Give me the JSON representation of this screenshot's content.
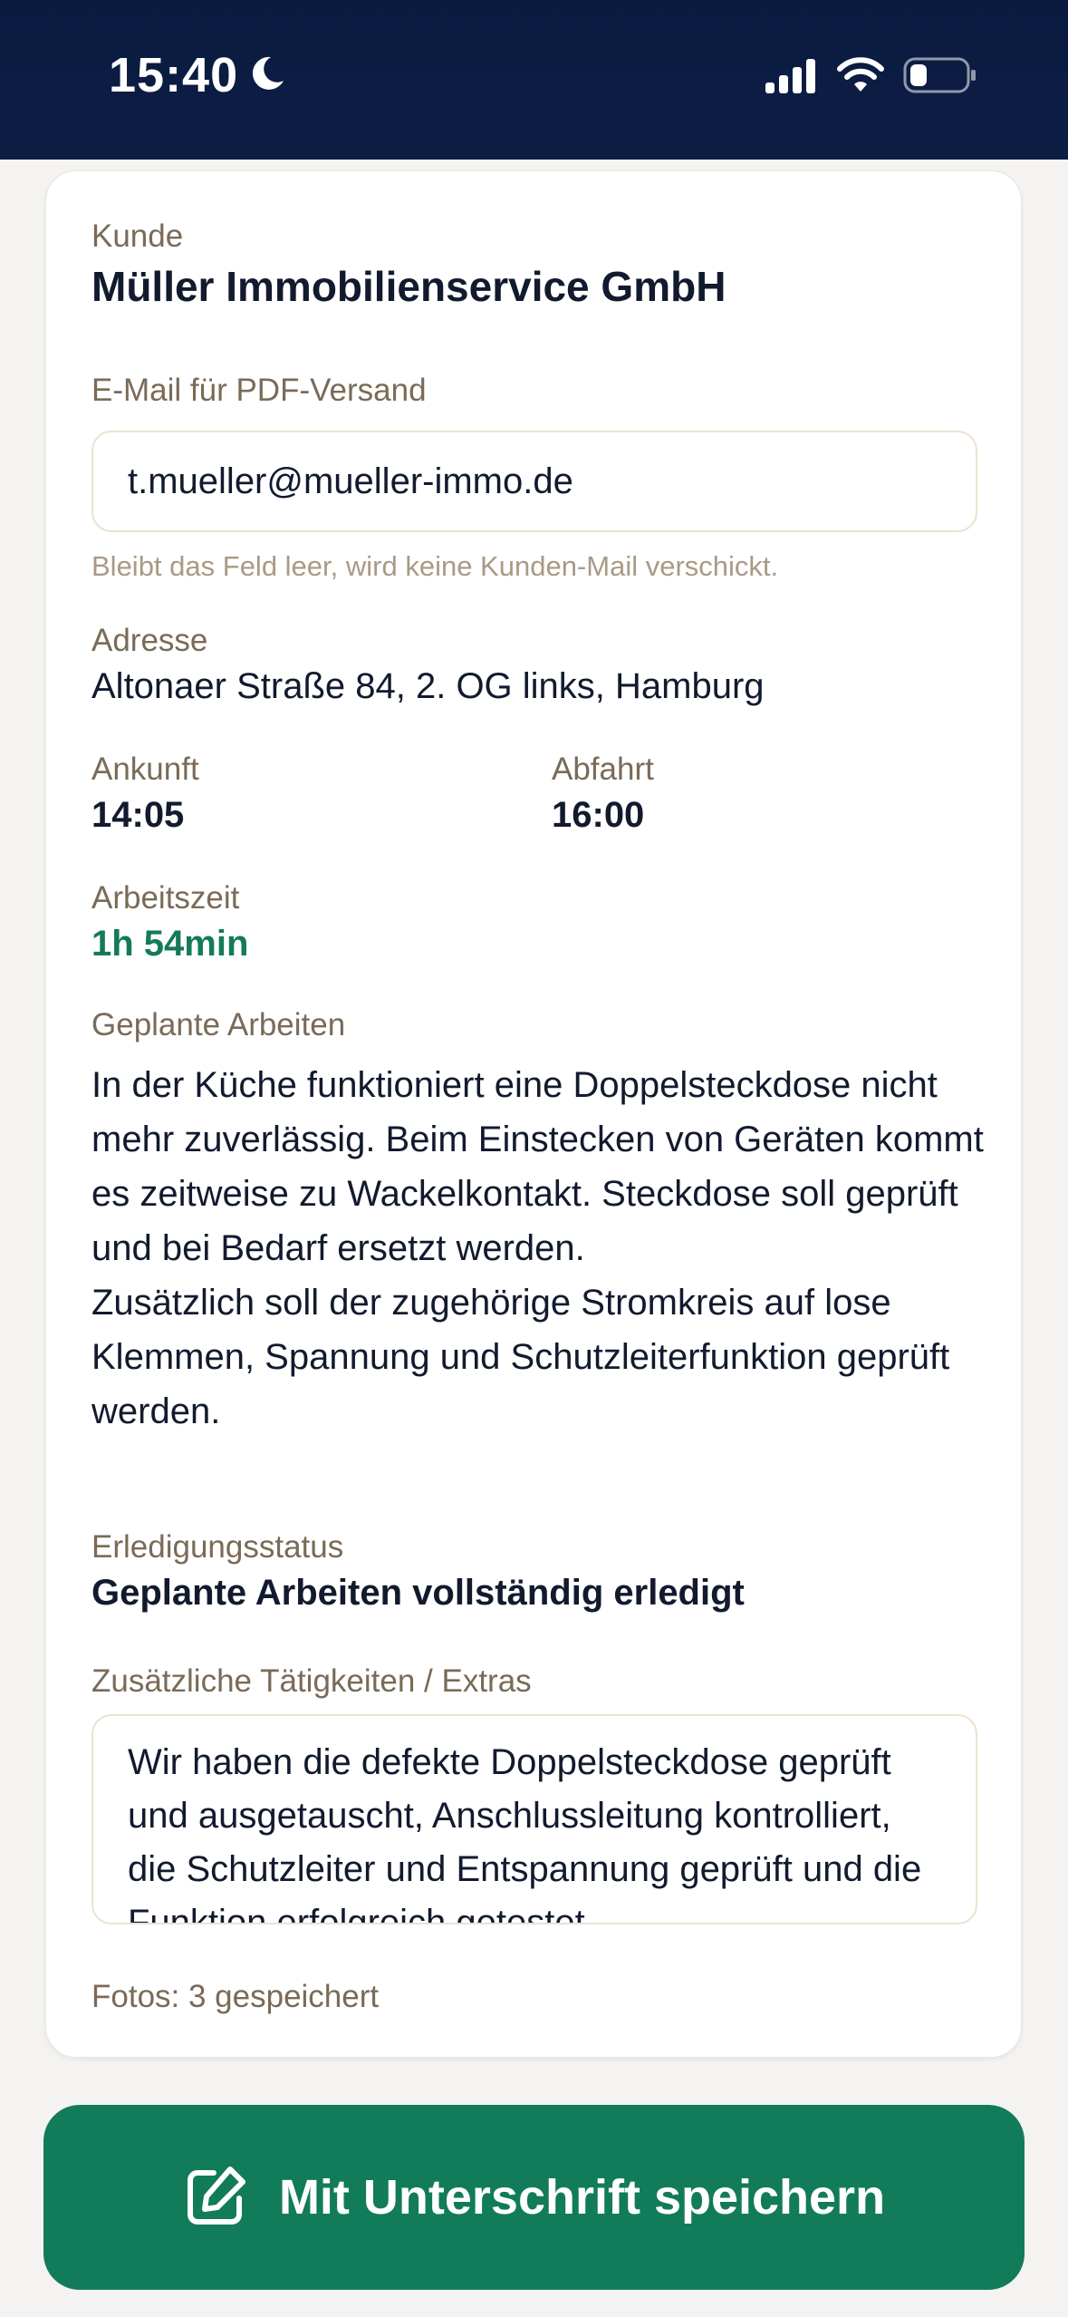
{
  "status_bar": {
    "time": "15:40",
    "icons": [
      "moon-icon",
      "signal-icon",
      "wifi-icon",
      "battery-icon"
    ]
  },
  "card": {
    "customer": {
      "label": "Kunde",
      "name": "Müller Immobilienservice GmbH"
    },
    "email": {
      "label": "E-Mail für PDF-Versand",
      "value": "t.mueller@mueller-immo.de",
      "hint": "Bleibt das Feld leer, wird keine Kunden-Mail verschickt."
    },
    "address": {
      "label": "Adresse",
      "value": "Altonaer Straße 84, 2. OG links, Hamburg"
    },
    "arrival": {
      "label": "Ankunft",
      "value": "14:05"
    },
    "departure": {
      "label": "Abfahrt",
      "value": "16:00"
    },
    "work_time": {
      "label": "Arbeitszeit",
      "value": "1h 54min"
    },
    "planned_work": {
      "label": "Geplante Arbeiten",
      "text": "In der Küche funktioniert eine Doppelsteckdose nicht mehr zuverlässig. Beim Einstecken von Geräten kommt es zeitweise zu Wackelkontakt. Steckdose soll geprüft und bei Bedarf ersetzt werden.\nZusätzlich soll der zugehörige Stromkreis auf lose Klemmen, Spannung und Schutzleiterfunktion geprüft werden."
    },
    "completion_status": {
      "label": "Erledigungsstatus",
      "value": "Geplante Arbeiten vollständig erledigt"
    },
    "extras": {
      "label": "Zusätzliche Tätigkeiten / Extras",
      "value": "Wir haben die defekte Doppelsteckdose geprüft und ausgetauscht, Anschlussleitung kontrolliert, die Schutzleiter und Entspannung geprüft und die Funktion erfolgreich getestet."
    },
    "photos": {
      "text": "Fotos: 3 gespeichert"
    }
  },
  "save_button": {
    "label": "Mit Unterschrift speichern",
    "icon": "edit-icon"
  },
  "colors": {
    "status_bar_bg": "#0A1A3F",
    "accent_green": "#127B5A",
    "label_brown": "#7A6A58",
    "hint_beige": "#A89A86",
    "input_border": "#ECE1D2",
    "text_dark": "#121A2E"
  }
}
